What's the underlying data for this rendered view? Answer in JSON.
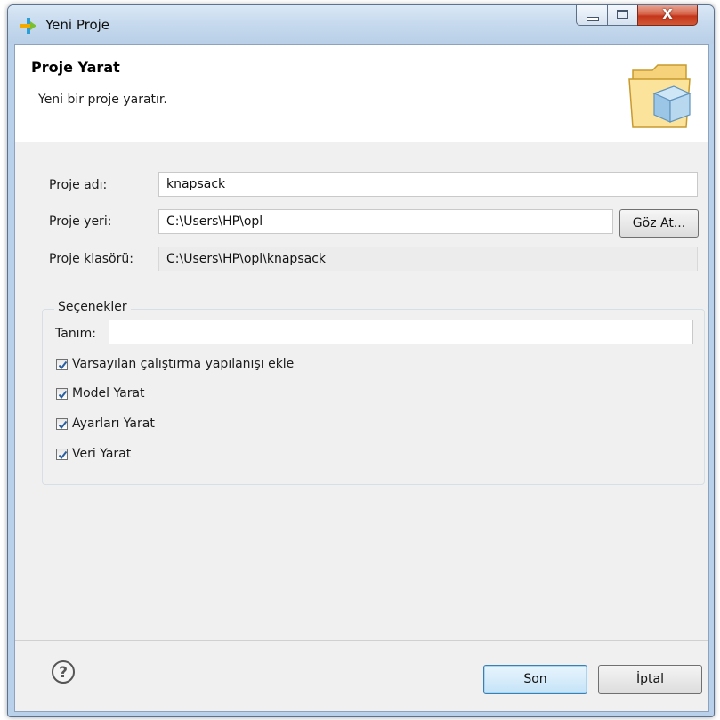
{
  "window": {
    "title": "Yeni Proje",
    "caption_close": "X",
    "icons": {
      "app": "plus-arrow-icon",
      "minimize": "minimize-icon",
      "maximize": "maximize-icon",
      "close": "close-icon"
    }
  },
  "banner": {
    "title": "Proje Yarat",
    "description": "Yeni bir proje yaratır.",
    "icon": "folder-cube-icon"
  },
  "form": {
    "name_label": "Proje adı:",
    "name_value": "knapsack",
    "location_label": "Proje yeri:",
    "location_value": "C:\\Users\\HP\\opl",
    "browse_button": "Göz At...",
    "folder_label": "Proje klasörü:",
    "folder_value": "C:\\Users\\HP\\opl\\knapsack"
  },
  "options": {
    "group_title": "Seçenekler",
    "description_label": "Tanım:",
    "description_value": "",
    "checkboxes": [
      {
        "label": "Varsayılan çalıştırma yapılanışı ekle",
        "checked": true
      },
      {
        "label": "Model Yarat",
        "checked": true
      },
      {
        "label": "Ayarları Yarat",
        "checked": true
      },
      {
        "label": "Veri Yarat",
        "checked": true
      }
    ]
  },
  "footer": {
    "help_icon": "help-icon",
    "finish_label": "Son",
    "cancel_label": "İptal"
  },
  "colors": {
    "title_bar": "#c7daee",
    "default_button_border": "#3c7fb1",
    "close_button": "#c4361b"
  }
}
